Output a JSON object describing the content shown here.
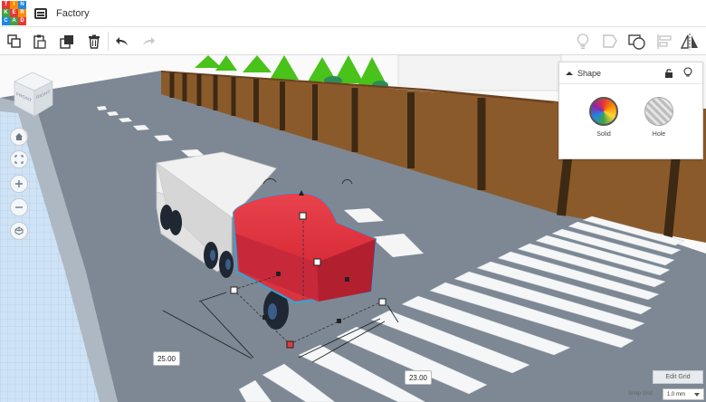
{
  "app": {
    "logo_letters": [
      "TIN",
      "KER",
      "CAD"
    ],
    "title": "Factory"
  },
  "toolbar": {
    "left_icons": [
      "copy-icon",
      "paste-icon",
      "duplicate-icon",
      "delete-icon",
      "undo-icon",
      "redo-icon"
    ],
    "right_icons": [
      "light-bulb-icon",
      "note-icon",
      "group-icon",
      "align-icon",
      "mirror-icon"
    ]
  },
  "view_cube": {
    "labels": [
      "FRONT",
      "RIGHT"
    ]
  },
  "view_controls": [
    "home-view-icon",
    "fit-view-icon",
    "zoom-in-icon",
    "zoom-out-icon",
    "perspective-icon"
  ],
  "shape_panel": {
    "title": "Shape",
    "options": [
      {
        "label": "Solid"
      },
      {
        "label": "Hole"
      }
    ]
  },
  "dimensions": {
    "length": "25.00",
    "width": "23.00"
  },
  "grid": {
    "edit_label": "Edit Grid",
    "snap_label": "Snap Grid",
    "snap_value": "1.0 mm"
  },
  "colors": {
    "truck_cab": "#e03440",
    "truck_trailer": "#eeeeee",
    "road": "#7d8894",
    "fence": "#8b5a2b",
    "trees": "#49c21a",
    "selection_outline": "#2aa7de"
  }
}
